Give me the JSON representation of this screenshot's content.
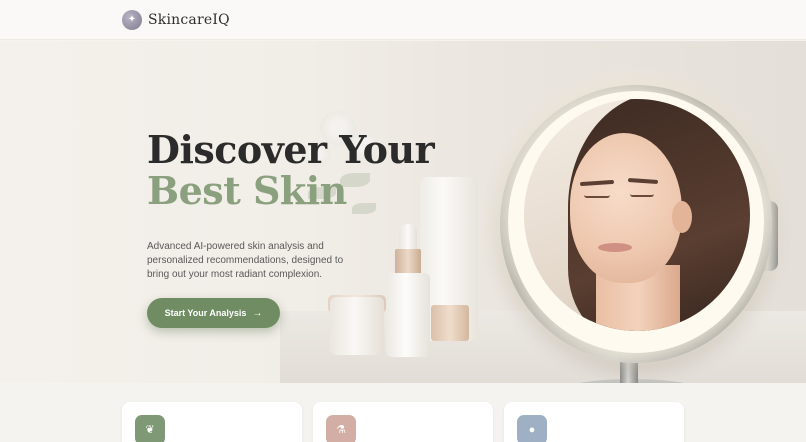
{
  "header": {
    "logo_icon": "sparkle-icon",
    "brand": "SkincareIQ"
  },
  "hero": {
    "title_line1": "Discover Your",
    "title_line2": "Best Skin",
    "description": "Advanced AI-powered skin analysis and personalized recommendations, designed to bring out your most radiant complexion.",
    "cta_label": "Start Your Analysis",
    "cta_icon": "arrow-right-icon",
    "image_subject": "woman-in-lit-mirror-with-skincare-products"
  },
  "features": [
    {
      "icon": "leaf-icon",
      "color": "#7f9876"
    },
    {
      "icon": "microscope-icon",
      "color": "#d2aea4"
    },
    {
      "icon": "drop-icon",
      "color": "#9fb0c4"
    }
  ],
  "colors": {
    "accent_green": "#6f8c63",
    "title_green": "#8ba07e",
    "background": "#f5f3ef"
  }
}
